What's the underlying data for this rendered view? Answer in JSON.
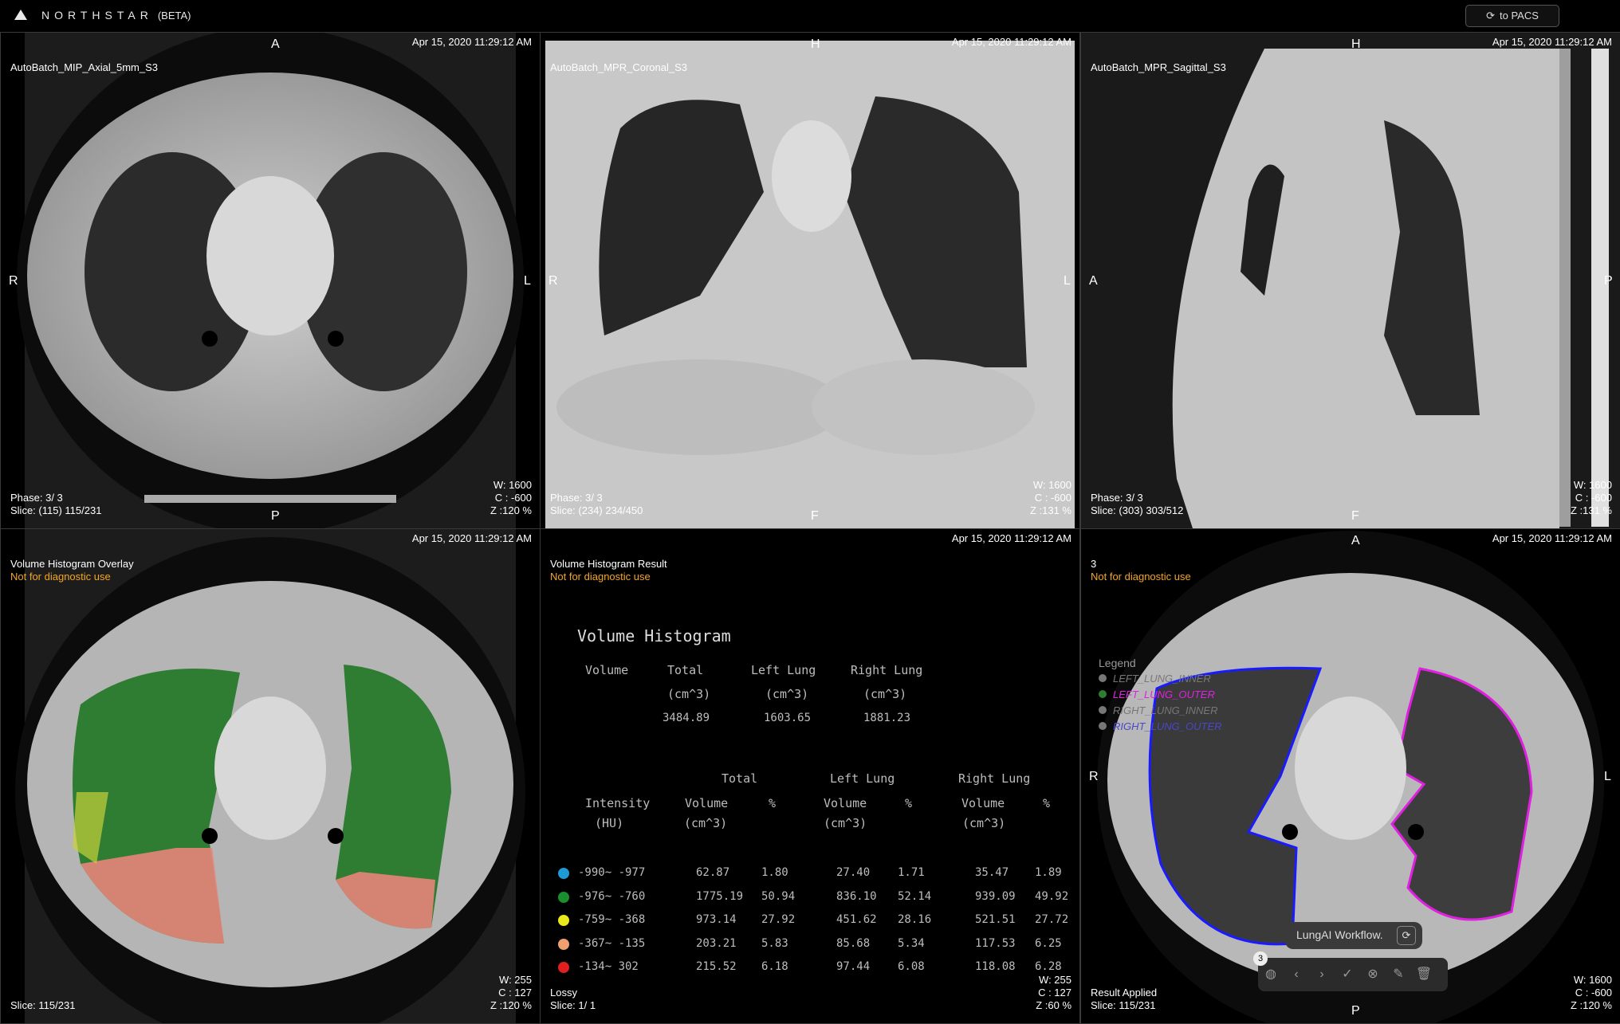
{
  "app": {
    "name": "NORTHSTAR",
    "tag": "(BETA)",
    "pacs_button": "to PACS"
  },
  "viewports": {
    "v1": {
      "title": "AutoBatch_MIP_Axial_5mm_S3",
      "date": "Apr 15, 2020 11:29:12 AM",
      "phase": "Phase: 3/ 3",
      "slice": "Slice: (115) 115/231",
      "w": "W: 1600",
      "c": "C : -600",
      "z": "Z :120 %",
      "top": "A",
      "bottom": "P",
      "left": "R",
      "right": "L"
    },
    "v2": {
      "title": "AutoBatch_MPR_Coronal_S3",
      "date": "Apr 15, 2020 11:29:12 AM",
      "phase": "Phase: 3/ 3",
      "slice": "Slice: (234) 234/450",
      "w": "W: 1600",
      "c": "C : -600",
      "z": "Z :131 %",
      "top": "H",
      "bottom": "F",
      "left": "R",
      "right": "L"
    },
    "v3": {
      "title": "AutoBatch_MPR_Sagittal_S3",
      "date": "Apr 15, 2020 11:29:12 AM",
      "phase": "Phase: 3/ 3",
      "slice": "Slice: (303) 303/512",
      "w": "W: 1600",
      "c": "C : -600",
      "z": "Z :131 %",
      "top": "H",
      "bottom": "F",
      "left": "A",
      "right": "P"
    },
    "v4": {
      "title": "Volume Histogram Overlay",
      "note": "Not for diagnostic use",
      "date": "Apr 15, 2020 11:29:12 AM",
      "slice": "Slice: 115/231",
      "w": "W: 255",
      "c": "C : 127",
      "z": "Z :120 %"
    },
    "v5": {
      "title": "Volume Histogram Result",
      "note": "Not for diagnostic use",
      "date": "Apr 15, 2020 11:29:12 AM",
      "lossy": "Lossy",
      "slice": "Slice: 1/ 1",
      "w": "W: 255",
      "c": "C : 127",
      "z": "Z :60 %"
    },
    "v6": {
      "title": "3",
      "note": "Not for diagnostic use",
      "date": "Apr 15, 2020 11:29:12 AM",
      "status": "Result Applied",
      "slice": "Slice: 115/231",
      "w": "W: 1600",
      "c": "C : -600",
      "z": "Z :120 %",
      "top": "A",
      "bottom": "P",
      "left": "R",
      "right": "L",
      "legend_title": "Legend",
      "legend": [
        {
          "label": "LEFT_LUNG_INNER",
          "color": "#777777"
        },
        {
          "label": "LEFT_LUNG_OUTER",
          "color": "#2e7d32"
        },
        {
          "label": "RIGHT_LUNG_INNER",
          "color": "#777777"
        },
        {
          "label": "RIGHT_LUNG_OUTER",
          "color": "#777777"
        }
      ],
      "workflow_label": "LungAI Workflow.",
      "toolbar_badge": "3"
    }
  },
  "histogram": {
    "title": "Volume Histogram",
    "summary_headers": [
      "Volume",
      "Total",
      "Left Lung",
      "Right Lung"
    ],
    "summary_units": [
      "(cm^3)",
      "(cm^3)",
      "(cm^3)"
    ],
    "summary_values": [
      "3484.89",
      "1603.65",
      "1881.23"
    ],
    "group_headers": [
      "Total",
      "Left Lung",
      "Right Lung"
    ],
    "col_intensity": "Intensity",
    "col_hu": "(HU)",
    "col_volume": "Volume",
    "col_pct": "%",
    "col_unit": "(cm^3)",
    "rows": [
      {
        "range": "-990~ -977",
        "color": "#1e9bd7",
        "tv": "62.87",
        "tp": "1.80",
        "lv": "27.40",
        "lp": "1.71",
        "rv": "35.47",
        "rp": "1.89"
      },
      {
        "range": "-976~ -760",
        "color": "#1a8f2e",
        "tv": "1775.19",
        "tp": "50.94",
        "lv": "836.10",
        "lp": "52.14",
        "rv": "939.09",
        "rp": "49.92"
      },
      {
        "range": "-759~ -368",
        "color": "#e8e81a",
        "tv": "973.14",
        "tp": "27.92",
        "lv": "451.62",
        "lp": "28.16",
        "rv": "521.51",
        "rp": "27.72"
      },
      {
        "range": "-367~ -135",
        "color": "#f0a070",
        "tv": "203.21",
        "tp": "5.83",
        "lv": "85.68",
        "lp": "5.34",
        "rv": "117.53",
        "rp": "6.25"
      },
      {
        "range": "-134~  302",
        "color": "#e02020",
        "tv": "215.52",
        "tp": "6.18",
        "lv": "97.44",
        "lp": "6.08",
        "rv": "118.08",
        "rp": "6.28"
      }
    ]
  },
  "colors": {
    "warning": "#f5a623",
    "left_contour": "#e020e0",
    "right_contour": "#1a1aff",
    "overlay_green": "#2e7d32",
    "overlay_yellow": "#c8d23a",
    "overlay_pink": "#e8857a"
  }
}
